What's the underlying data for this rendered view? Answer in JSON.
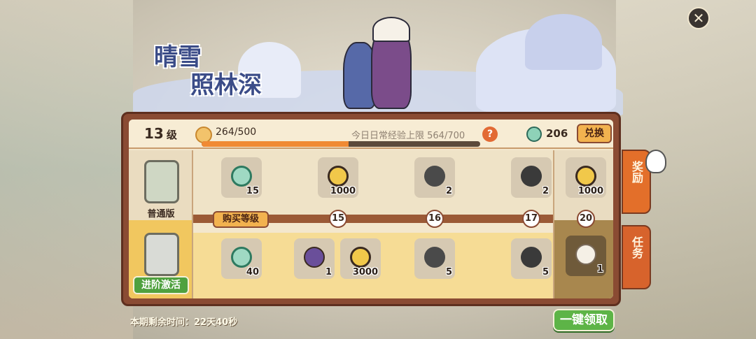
{
  "header": {
    "title_line1": "晴雪",
    "title_line2": "照林深",
    "close_icon": "close-icon"
  },
  "top_bar": {
    "level_value": "13",
    "level_unit": "级",
    "exp_text": "264/500",
    "exp_progress": 0.528,
    "daily_label": "今日日常经验上限 564/700",
    "help_symbol": "?",
    "coin_count": "206",
    "exchange_label": "兑换"
  },
  "tiers": {
    "normal_label": "普通版",
    "activate_label": "进阶激活"
  },
  "track": {
    "buy_label": "购买等级",
    "levels": [
      "15",
      "16",
      "17",
      "20"
    ]
  },
  "normal_rewards": [
    {
      "icon": "jade-coin-icon",
      "qty": "15"
    },
    {
      "icon": "gold-coin-icon",
      "qty": "1000"
    },
    {
      "icon": "hammer-icon",
      "qty": "2"
    },
    {
      "icon": "shovel-icon",
      "qty": "2"
    },
    {
      "icon": "gold-coin-icon",
      "qty": "1000"
    }
  ],
  "adv_rewards": [
    {
      "icon": "jade-coin-icon",
      "qty": "40"
    },
    {
      "icon": "hat-icon",
      "qty": "1"
    },
    {
      "icon": "gold-coin-icon",
      "qty": "3000"
    },
    {
      "icon": "hammer-icon",
      "qty": "5"
    },
    {
      "icon": "shovel-icon",
      "qty": "5"
    },
    {
      "icon": "fur-tail-icon",
      "qty": "1"
    }
  ],
  "side_tabs": {
    "reward": "奖励",
    "task": "任务"
  },
  "footer": {
    "timer_text": "本期剩余时间：22天40秒",
    "claim_label": "一键领取"
  },
  "colors": {
    "accent": "#f2b24f",
    "panel_border": "#8a4b33",
    "claim": "#5db447",
    "tab": "#e36f2a"
  }
}
